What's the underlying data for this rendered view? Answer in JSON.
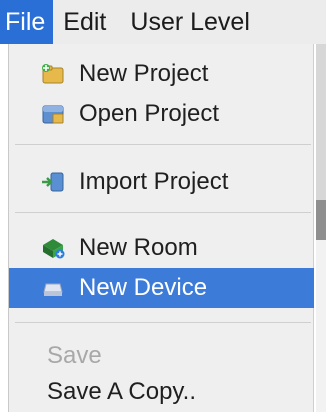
{
  "menubar": {
    "items": [
      {
        "label": "File"
      },
      {
        "label": "Edit"
      },
      {
        "label": "User Level"
      }
    ]
  },
  "file_menu": {
    "items": [
      {
        "label": "New Project",
        "icon": "new-project-icon"
      },
      {
        "label": "Open Project",
        "icon": "open-project-icon"
      },
      {
        "label": "Import Project",
        "icon": "import-project-icon"
      },
      {
        "label": "New Room",
        "icon": "new-room-icon"
      },
      {
        "label": "New Device",
        "icon": "new-device-icon",
        "state": "highlighted"
      },
      {
        "label": "Save",
        "state": "disabled"
      },
      {
        "label": "Save A Copy.."
      }
    ]
  },
  "colors": {
    "menubar_active": "#2a6fd6",
    "selected_item": "#3d7bd9",
    "menu_background": "#efefef",
    "disabled_text": "#a8a8a8"
  }
}
